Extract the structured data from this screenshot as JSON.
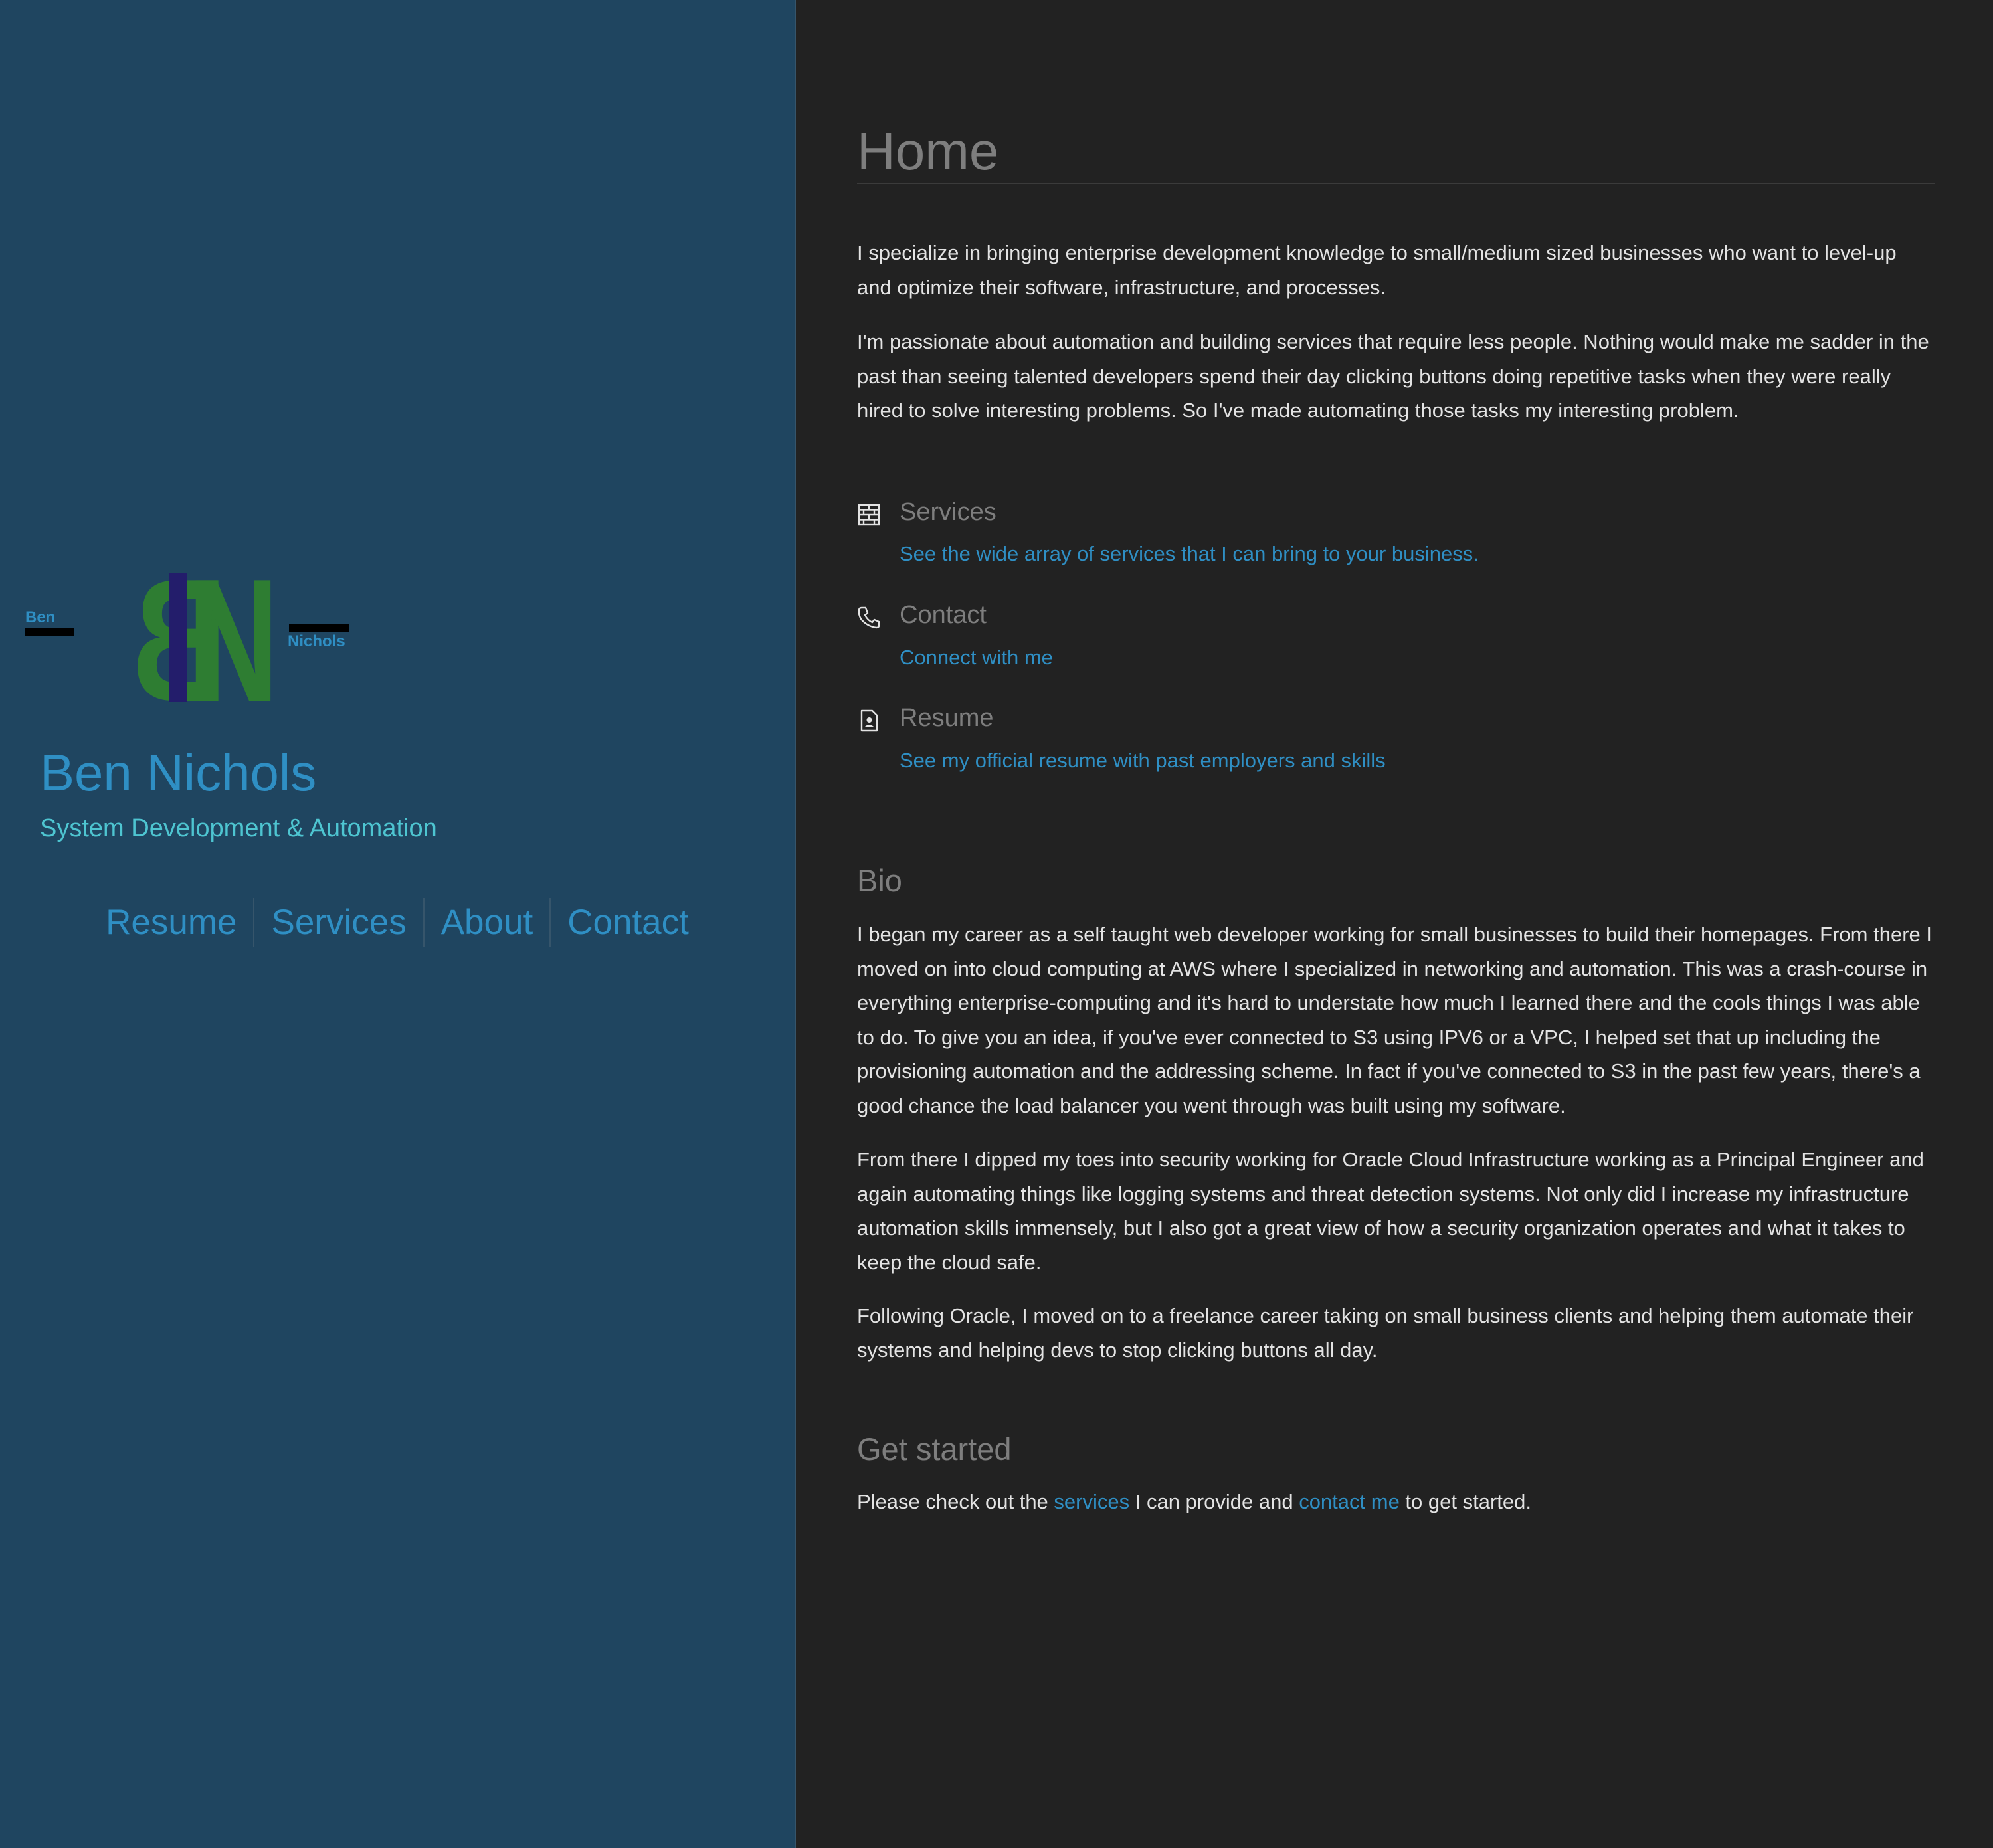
{
  "sidebar": {
    "logo": {
      "first": "Ben",
      "last": "Nichols",
      "initials": "BN",
      "colors": {
        "letters": "#2e7d32",
        "bar": "#231d6b",
        "accent": "#2f8fc4"
      }
    },
    "name": "Ben Nichols",
    "tagline": "System Development & Automation",
    "nav": [
      "Resume",
      "Services",
      "About",
      "Contact"
    ]
  },
  "main": {
    "title": "Home",
    "intro": [
      "I specialize in bringing enterprise development knowledge to small/medium sized businesses who want to level-up and optimize their software, infrastructure, and processes.",
      "I'm passionate about automation and building services that require less people. Nothing would make me sadder in the past than seeing talented developers spend their day clicking buttons doing repetitive tasks when they were really hired to solve interesting problems. So I've made automating those tasks my interesting problem."
    ],
    "links": [
      {
        "icon": "brick-wall-icon",
        "heading": "Services",
        "desc": "See the wide array of services that I can bring to your business."
      },
      {
        "icon": "phone-icon",
        "heading": "Contact",
        "desc": "Connect with me"
      },
      {
        "icon": "resume-icon",
        "heading": "Resume",
        "desc": "See my official resume with past employers and skills"
      }
    ],
    "bio": {
      "title": "Bio",
      "paragraphs": [
        "I began my career as a self taught web developer working for small businesses to build their homepages. From there I moved on into cloud computing at AWS where I specialized in networking and automation. This was a crash-course in everything enterprise-computing and it's hard to understate how much I learned there and the cools things I was able to do. To give you an idea, if you've ever connected to S3 using IPV6 or a VPC, I helped set that up including the provisioning automation and the addressing scheme. In fact if you've connected to S3 in the past few years, there's a good chance the load balancer you went through was built using my software.",
        "From there I dipped my toes into security working for Oracle Cloud Infrastructure working as a Principal Engineer and again automating things like logging systems and threat detection systems. Not only did I increase my infrastructure automation skills immensely, but I also got a great view of how a security organization operates and what it takes to keep the cloud safe.",
        "Following Oracle, I moved on to a freelance career taking on small business clients and helping them automate their systems and helping devs to stop clicking buttons all day."
      ]
    },
    "get_started": {
      "title": "Get started",
      "text_before": "Please check out the ",
      "link1": "services",
      "text_middle": " I can provide and ",
      "link2": "contact me",
      "text_after": " to get started."
    }
  }
}
